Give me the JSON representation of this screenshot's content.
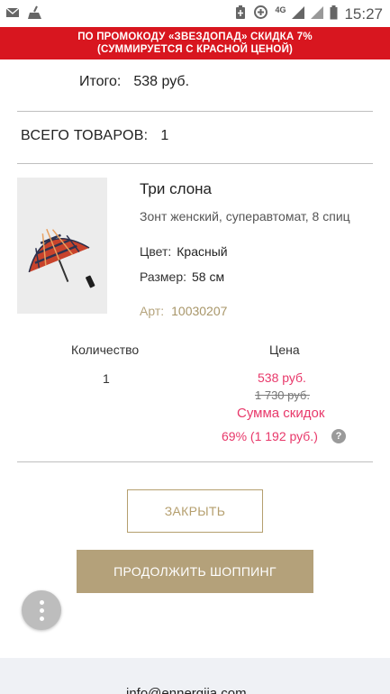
{
  "status_bar": {
    "time": "15:27",
    "network": "4G",
    "icons": [
      "mail-icon",
      "broom-icon",
      "battery-saver-icon",
      "data-saver-icon",
      "signal-icon",
      "wifi-icon",
      "battery-icon"
    ]
  },
  "promo_banner": {
    "line1": "ПО ПРОМОКОДУ «ЗВЕЗДОПАД» СКИДКА 7%",
    "line2": "(СУММИРУЕТСЯ С КРАСНОЙ ЦЕНОЙ)",
    "color": "#d8161f"
  },
  "summary": {
    "total_label": "Итого:",
    "total_value": "538 руб.",
    "items_label": "ВСЕГО ТОВАРОВ:",
    "items_value": "1"
  },
  "product": {
    "brand": "Три слона",
    "description": "Зонт женский, суперавтомат, 8 спиц",
    "color_label": "Цвет:",
    "color_value": "Красный",
    "size_label": "Размер:",
    "size_value": "58 см",
    "art_label": "Арт:",
    "art_value": "10030207"
  },
  "order_table": {
    "qty_header": "Количество",
    "price_header": "Цена",
    "qty": "1",
    "price_new": "538 руб.",
    "price_old": "1 730 руб.",
    "discount_label": "Сумма скидок",
    "discount_value": "69% (1 192 руб.)"
  },
  "buttons": {
    "close": "ЗАКРЫТЬ",
    "continue": "ПРОДОЛЖИТЬ ШОППИНГ"
  },
  "footer": {
    "email": "info@ennergiia.com"
  },
  "colors": {
    "accent_gold": "#b4a17a",
    "price_pink": "#e8386a"
  }
}
